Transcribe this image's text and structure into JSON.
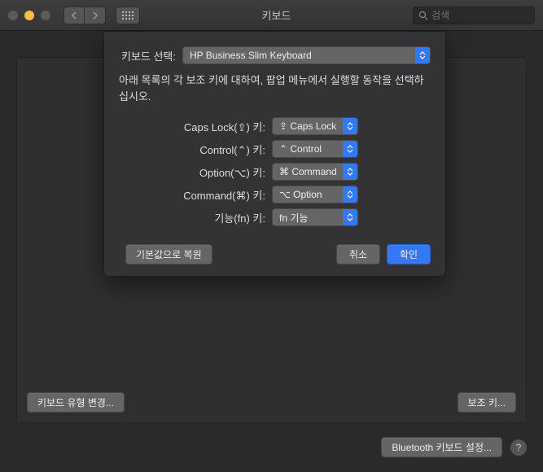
{
  "window": {
    "title": "키보드",
    "search_placeholder": "검색"
  },
  "sheet": {
    "keyboard_select_label": "키보드 선택:",
    "keyboard_selected": "HP Business Slim Keyboard",
    "description": "아래 목록의 각 보조 키에 대하여, 팝업 메뉴에서 실행할 동작을 선택하십시오.",
    "keys": [
      {
        "label": "Caps Lock(⇪) 키:",
        "value": "⇪ Caps Lock"
      },
      {
        "label": "Control(⌃) 키:",
        "value": "⌃ Control"
      },
      {
        "label": "Option(⌥) 키:",
        "value": "⌘ Command"
      },
      {
        "label": "Command(⌘) 키:",
        "value": "⌥ Option"
      },
      {
        "label": "기능(fn) 키:",
        "value": "fn 기능"
      }
    ],
    "restore_defaults": "기본값으로 복원",
    "cancel": "취소",
    "ok": "확인"
  },
  "main_panel": {
    "change_keyboard_type": "키보드 유형 변경...",
    "modifier_keys": "보조 키..."
  },
  "bottom": {
    "bluetooth_setup": "Bluetooth 키보드 설정...",
    "help": "?"
  }
}
